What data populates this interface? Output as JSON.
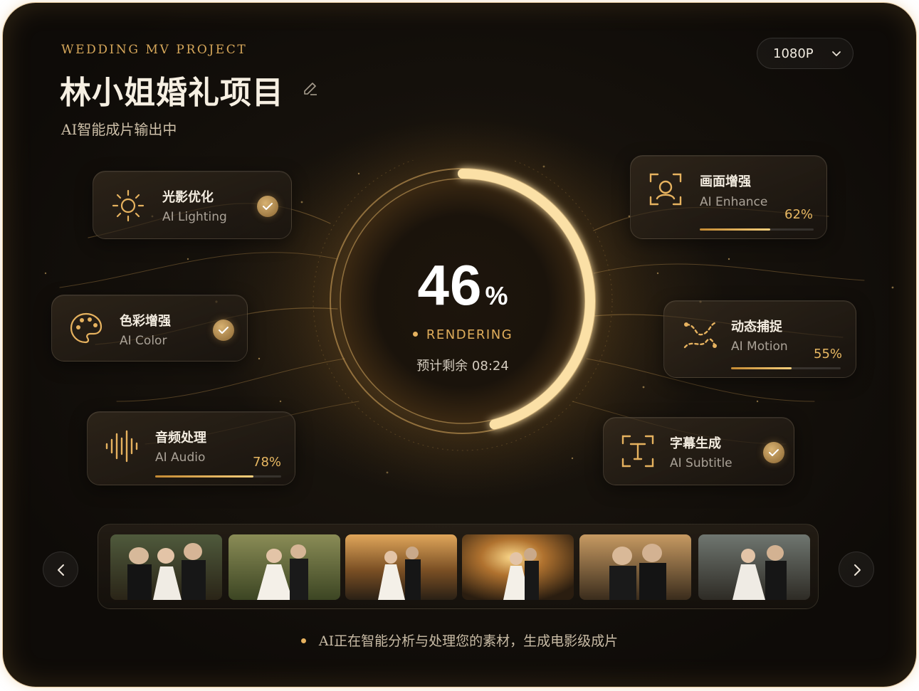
{
  "header": {
    "eyebrow": "WEDDING MV PROJECT",
    "title": "林小姐婚礼项目",
    "subtitle": "AI智能成片输出中",
    "edit_icon": "pencil-icon"
  },
  "resolution": {
    "value": "1080P",
    "icon": "chevron-down-icon"
  },
  "progress": {
    "percent": "46",
    "percent_sign": "%",
    "value": 0.46,
    "status": "RENDERING",
    "eta": "预计剩余 08:24"
  },
  "tasks": [
    {
      "key": "lighting",
      "cn": "光影优化",
      "en": "AI Lighting",
      "icon": "sun-icon",
      "done": true
    },
    {
      "key": "color",
      "cn": "色彩增强",
      "en": "AI Color",
      "icon": "palette-icon",
      "done": true
    },
    {
      "key": "audio",
      "cn": "音频处理",
      "en": "AI Audio",
      "icon": "waveform-icon",
      "done": false,
      "percent": "78%",
      "value": 0.78
    },
    {
      "key": "enhance",
      "cn": "画面增强",
      "en": "AI Enhance",
      "icon": "face-scan-icon",
      "done": false,
      "percent": "62%",
      "value": 0.62
    },
    {
      "key": "motion",
      "cn": "动态捕捉",
      "en": "AI Motion",
      "icon": "motion-path-icon",
      "done": false,
      "percent": "55%",
      "value": 0.55
    },
    {
      "key": "subtitle",
      "cn": "字幕生成",
      "en": "AI Subtitle",
      "icon": "text-frame-icon",
      "done": true
    }
  ],
  "filmstrip": {
    "prev_icon": "chevron-left-icon",
    "next_icon": "chevron-right-icon",
    "frames": [
      "wedding-couple-thumbnail",
      "wedding-couple-thumbnail",
      "wedding-couple-thumbnail",
      "wedding-couple-thumbnail",
      "wedding-couple-thumbnail",
      "wedding-couple-thumbnail"
    ]
  },
  "footer": {
    "message": "AI正在智能分析与处理您的素材，生成电影级成片"
  },
  "colors": {
    "accent": "#e6b25f",
    "background": "#120e0a",
    "text": "#f6efe2"
  }
}
